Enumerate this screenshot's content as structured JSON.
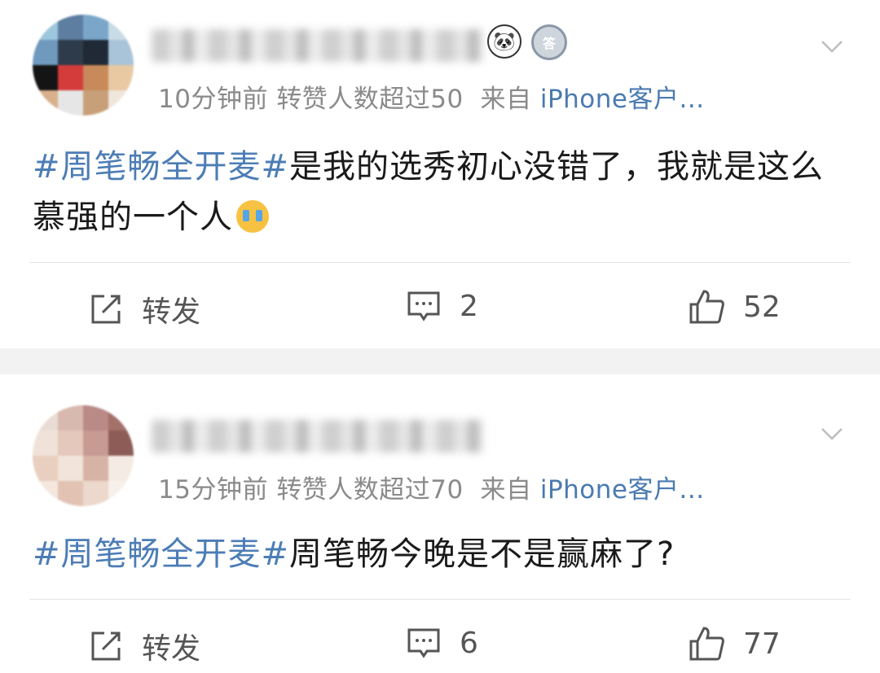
{
  "posts": [
    {
      "meta": {
        "time": "10分钟前",
        "reposts_note": "转赞人数超过50",
        "from_label": "来自",
        "source": "iPhone客户..."
      },
      "content": {
        "topic": "#周笔畅全开麦#",
        "text": "是我的选秀初心没错了，我就是这么慕强的一个人"
      },
      "emoji_icon": "crying-face-icon",
      "actions": {
        "repost_label": "转发",
        "comment_count": "2",
        "like_count": "52"
      }
    },
    {
      "meta": {
        "time": "15分钟前",
        "reposts_note": "转赞人数超过70",
        "from_label": "来自",
        "source": "iPhone客户..."
      },
      "content": {
        "topic": "#周笔畅全开麦#",
        "text": "周笔畅今晚是不是赢麻了?"
      },
      "actions": {
        "repost_label": "转发",
        "comment_count": "6",
        "like_count": "77"
      }
    }
  ],
  "colors": {
    "topic": "#4c7db5",
    "meta": "#8a8a8a",
    "separator": "#f2f2f2"
  },
  "icons": [
    "panda-badge-icon",
    "medal-badge-icon",
    "chevron-down-icon",
    "repost-icon",
    "comment-icon",
    "like-icon"
  ]
}
